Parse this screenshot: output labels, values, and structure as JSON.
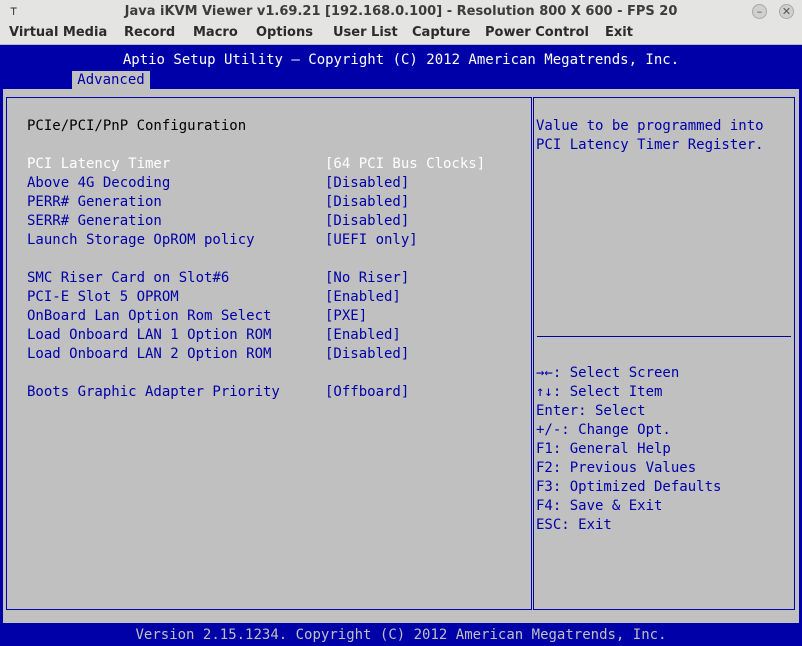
{
  "window": {
    "title": "Java iKVM Viewer v1.69.21 [192.168.0.100]  - Resolution 800 X 600 - FPS 20",
    "pin_icon": "pin-icon",
    "min_label": "–",
    "close_label": "✕"
  },
  "menu": {
    "items": [
      "Virtual Media",
      "Record",
      "Macro",
      "Options",
      "User List",
      "Capture",
      "Power Control",
      "Exit"
    ]
  },
  "bios": {
    "header_title": "Aptio Setup Utility – Copyright (C) 2012 American Megatrends, Inc.",
    "active_tab": "Advanced",
    "section_title": "PCIe/PCI/PnP Configuration",
    "settings": [
      {
        "label": "PCI Latency Timer",
        "value": "[64 PCI Bus Clocks]",
        "selected": true
      },
      {
        "label": "Above 4G Decoding",
        "value": "[Disabled]"
      },
      {
        "label": "PERR# Generation",
        "value": "[Disabled]"
      },
      {
        "label": "SERR# Generation",
        "value": "[Disabled]"
      },
      {
        "label": "Launch Storage OpROM policy",
        "value": "[UEFI only]"
      },
      {
        "label": "SMC Riser Card on Slot#6",
        "value": "[No Riser]"
      },
      {
        "label": "PCI-E Slot 5 OPROM",
        "value": "[Enabled]"
      },
      {
        "label": "OnBoard Lan Option Rom Select",
        "value": "[PXE]"
      },
      {
        "label": "Load Onboard LAN 1 Option ROM",
        "value": "[Enabled]"
      },
      {
        "label": "Load Onboard LAN 2 Option ROM",
        "value": "[Disabled]"
      },
      {
        "label": "Boots Graphic Adapter Priority",
        "value": "[Offboard]"
      }
    ],
    "help": [
      "Value to be programmed into",
      "PCI Latency Timer Register."
    ],
    "keys": [
      "→←: Select Screen",
      "↑↓: Select Item",
      "Enter: Select",
      "+/-: Change Opt.",
      "F1: General Help",
      "F2: Previous Values",
      "F3: Optimized Defaults",
      "F4: Save & Exit",
      "ESC: Exit"
    ],
    "footer": "Version 2.15.1234. Copyright (C) 2012 American Megatrends, Inc."
  },
  "colors": {
    "bios_blue": "#0000a8",
    "bios_gray": "#c0c0c0",
    "selected_text": "#ffffff",
    "chrome": "#e4e4e2"
  }
}
